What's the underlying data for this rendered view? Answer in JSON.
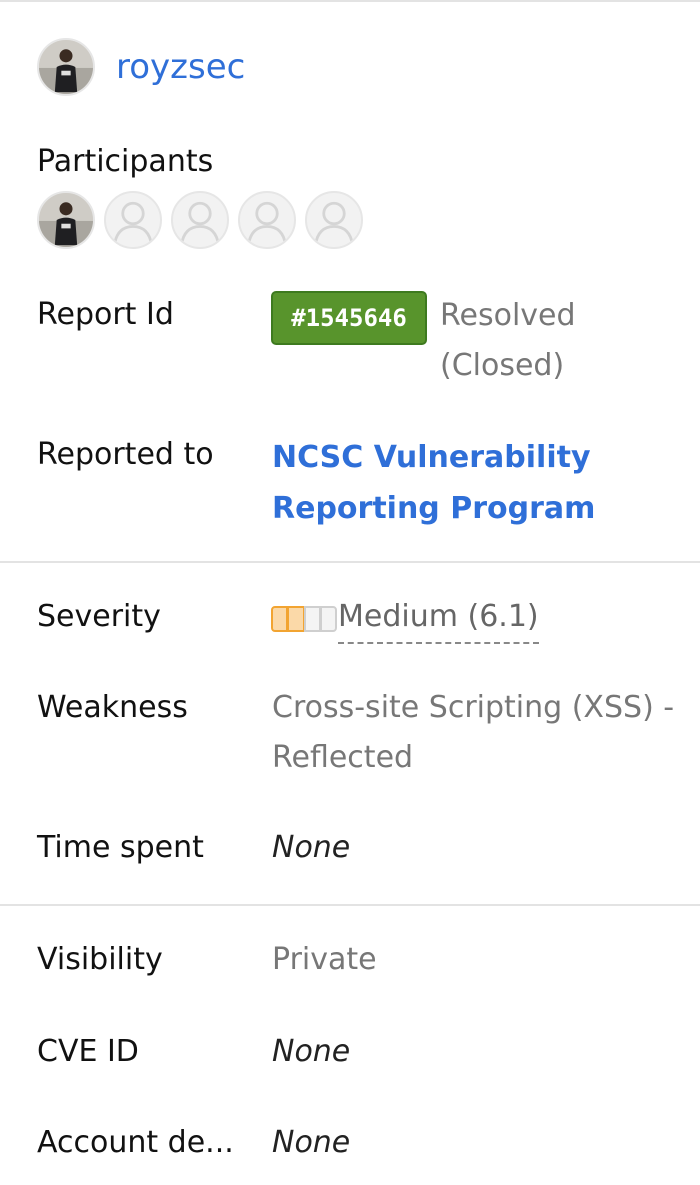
{
  "header": {
    "username": "royzsec"
  },
  "participants": {
    "label": "Participants",
    "count_filled": 1,
    "count_empty": 4
  },
  "fields": {
    "report_id": {
      "label": "Report Id",
      "id": "#1545646",
      "status_line1": "Resolved",
      "status_line2": "(Closed)",
      "badge_color": "#58942c"
    },
    "reported_to": {
      "label": "Reported to",
      "line1": "NCSC Vulnerability",
      "line2": "Reporting Program"
    },
    "severity": {
      "label": "Severity",
      "value": "Medium (6.1)",
      "level": 2,
      "level_max": 4,
      "color": "#f2a431"
    },
    "weakness": {
      "label": "Weakness",
      "line1": "Cross-site Scripting (XSS) -",
      "line2": "Reflected"
    },
    "time_spent": {
      "label": "Time spent",
      "value": "None"
    },
    "visibility": {
      "label": "Visibility",
      "value": "Private"
    },
    "cve_id": {
      "label": "CVE ID",
      "value": "None"
    },
    "account_details": {
      "label": "Account de...",
      "value": "None"
    }
  },
  "colors": {
    "link": "#2f6fd8",
    "muted": "#777777"
  }
}
